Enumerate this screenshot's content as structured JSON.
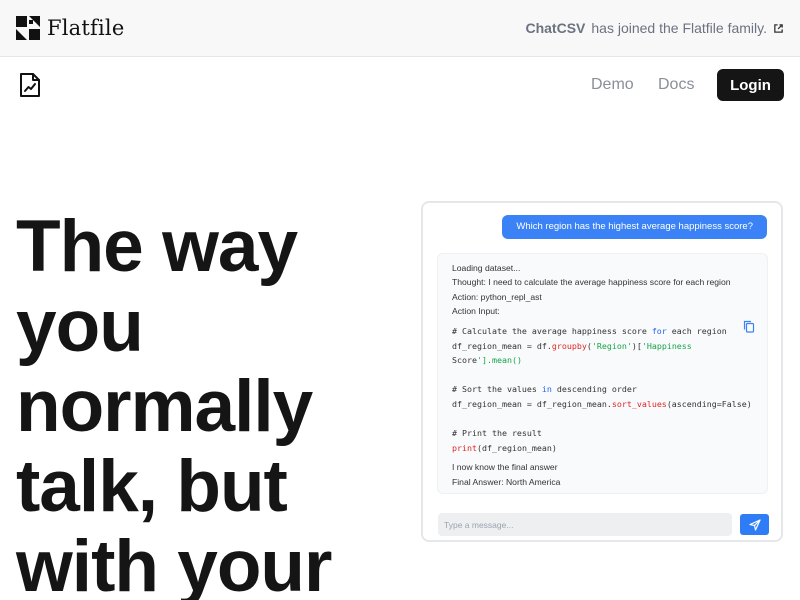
{
  "banner": {
    "brand_name": "Flatfile",
    "announcement_bold": "ChatCSV",
    "announcement_rest": "has joined the Flatfile family.",
    "logo_icon": "flatfile-logo-icon",
    "link_icon": "external-link-icon"
  },
  "nav": {
    "app_icon": "document-chart-icon",
    "links": [
      {
        "label": "Demo"
      },
      {
        "label": "Docs"
      }
    ],
    "login_label": "Login"
  },
  "hero": {
    "lines": [
      "The way",
      "you",
      "normally",
      "talk, but",
      "with your"
    ]
  },
  "chat": {
    "user_question": "Which region has the highest average happiness score?",
    "response_lines": [
      "Loading dataset...",
      "Thought: I need to calculate the average happiness score for each region",
      "Action: python_repl_ast",
      "Action Input:"
    ],
    "code_lines": [
      "# Calculate the average happiness score for each region",
      "df_region_mean = df.groupby('Region')['Happiness",
      "Score'].mean()",
      "",
      "# Sort the values in descending order",
      "df_region_mean = df_region_mean.sort_values(ascending=False)",
      "",
      "# Print the result",
      "print(df_region_mean)"
    ],
    "final_lines": [
      " I now know the final answer",
      "Final Answer: North America"
    ],
    "input_placeholder": "Type a message...",
    "copy_icon": "copy-icon",
    "send_icon": "send-icon"
  },
  "colors": {
    "accent_blue": "#3b82f6",
    "login_bg": "#151515",
    "banner_bg": "#f8f8f8"
  }
}
